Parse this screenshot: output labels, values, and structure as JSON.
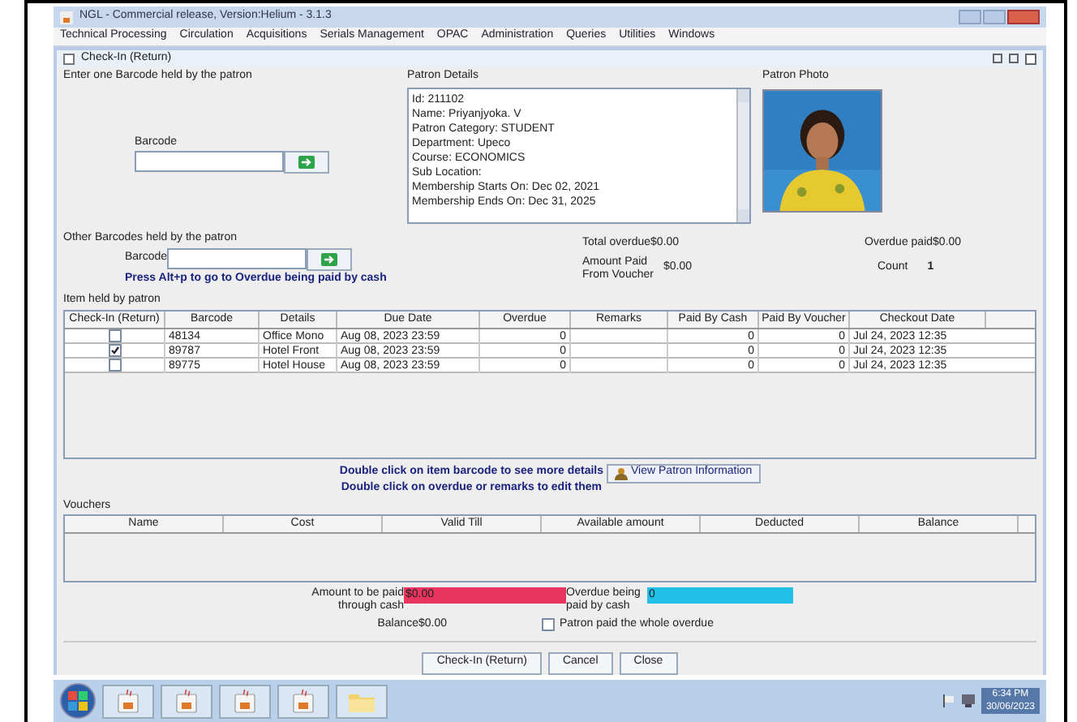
{
  "window": {
    "title": "NGL - Commercial release, Version:Helium - 3.1.3"
  },
  "menu": [
    "Technical Processing",
    "Circulation",
    "Acquisitions",
    "Serials Management",
    "OPAC",
    "Administration",
    "Queries",
    "Utilities",
    "Windows"
  ],
  "frame": {
    "title": "Check-In (Return)"
  },
  "barcode_section": {
    "title": "Enter one Barcode held by the patron",
    "label": "Barcode"
  },
  "patron_details": {
    "title": "Patron Details",
    "lines": [
      "Id: 211102",
      "Name: Priyanjyoka. V",
      "Patron Category: STUDENT",
      "Department: Upeco",
      "Course: ECONOMICS",
      "Sub Location:",
      "Membership Starts On: Dec 02, 2021",
      "Membership Ends On: Dec 31, 2025"
    ]
  },
  "patron_photo": {
    "title": "Patron Photo",
    "kind": "picture"
  },
  "other_barcodes": {
    "title": "Other Barcodes held by the patron",
    "label": "Barcode",
    "hint": "Press Alt+p to go to Overdue being paid by cash"
  },
  "totals": {
    "total_overdue_label": "Total overdue",
    "total_overdue": "$0.00",
    "amount_paid_label": "Amount Paid From Voucher",
    "amount_paid": "$0.00",
    "overdue_paid_label": "Overdue paid",
    "overdue_paid": "$0.00",
    "count_label": "Count",
    "count": "1"
  },
  "items": {
    "title": "Item held by patron",
    "columns": [
      "Check-In (Return)",
      "Barcode",
      "Details",
      "Due Date",
      "Overdue",
      "Remarks",
      "Paid By Cash",
      "Paid By Voucher",
      "Checkout Date"
    ],
    "rows": [
      {
        "checked": false,
        "barcode": "48134",
        "details": "Office Mono",
        "due": "Aug 08, 2023 23:59",
        "overdue": "0",
        "remarks": "",
        "cash": "0",
        "voucher": "0",
        "checkout": "Jul 24, 2023 12:35"
      },
      {
        "checked": true,
        "barcode": "89787",
        "details": "Hotel Front",
        "due": "Aug 08, 2023 23:59",
        "overdue": "0",
        "remarks": "",
        "cash": "0",
        "voucher": "0",
        "checkout": "Jul 24, 2023 12:35"
      },
      {
        "checked": false,
        "barcode": "89775",
        "details": "Hotel House",
        "due": "Aug 08, 2023 23:59",
        "overdue": "0",
        "remarks": "",
        "cash": "0",
        "voucher": "0",
        "checkout": "Jul 24, 2023 12:35"
      }
    ]
  },
  "instructions": [
    "Double click on item barcode to see more details",
    "Double click on overdue or remarks to edit them"
  ],
  "view_patron_button": "View Patron Information",
  "vouchers": {
    "title": "Vouchers",
    "columns": [
      "Name",
      "Cost",
      "Valid Till",
      "Available amount",
      "Deducted",
      "Balance"
    ]
  },
  "payment": {
    "cash_label": "Amount to be paid through cash",
    "cash_value": "$0.00",
    "overdue_label": "Overdue being paid by cash",
    "overdue_value": "0",
    "balance_label": "Balance",
    "balance_value": "$0.00",
    "whole_label": "Patron paid the whole overdue",
    "whole_checked": false
  },
  "buttons": [
    "Check-In (Return)",
    "Cancel",
    "Close"
  ],
  "taskbar": {
    "apps": [
      {
        "kind": "app"
      },
      {
        "kind": "app"
      },
      {
        "kind": "app"
      },
      {
        "kind": "app"
      },
      {
        "kind": "folder"
      }
    ],
    "time": "6:34 PM",
    "date": "30/06/2023"
  }
}
